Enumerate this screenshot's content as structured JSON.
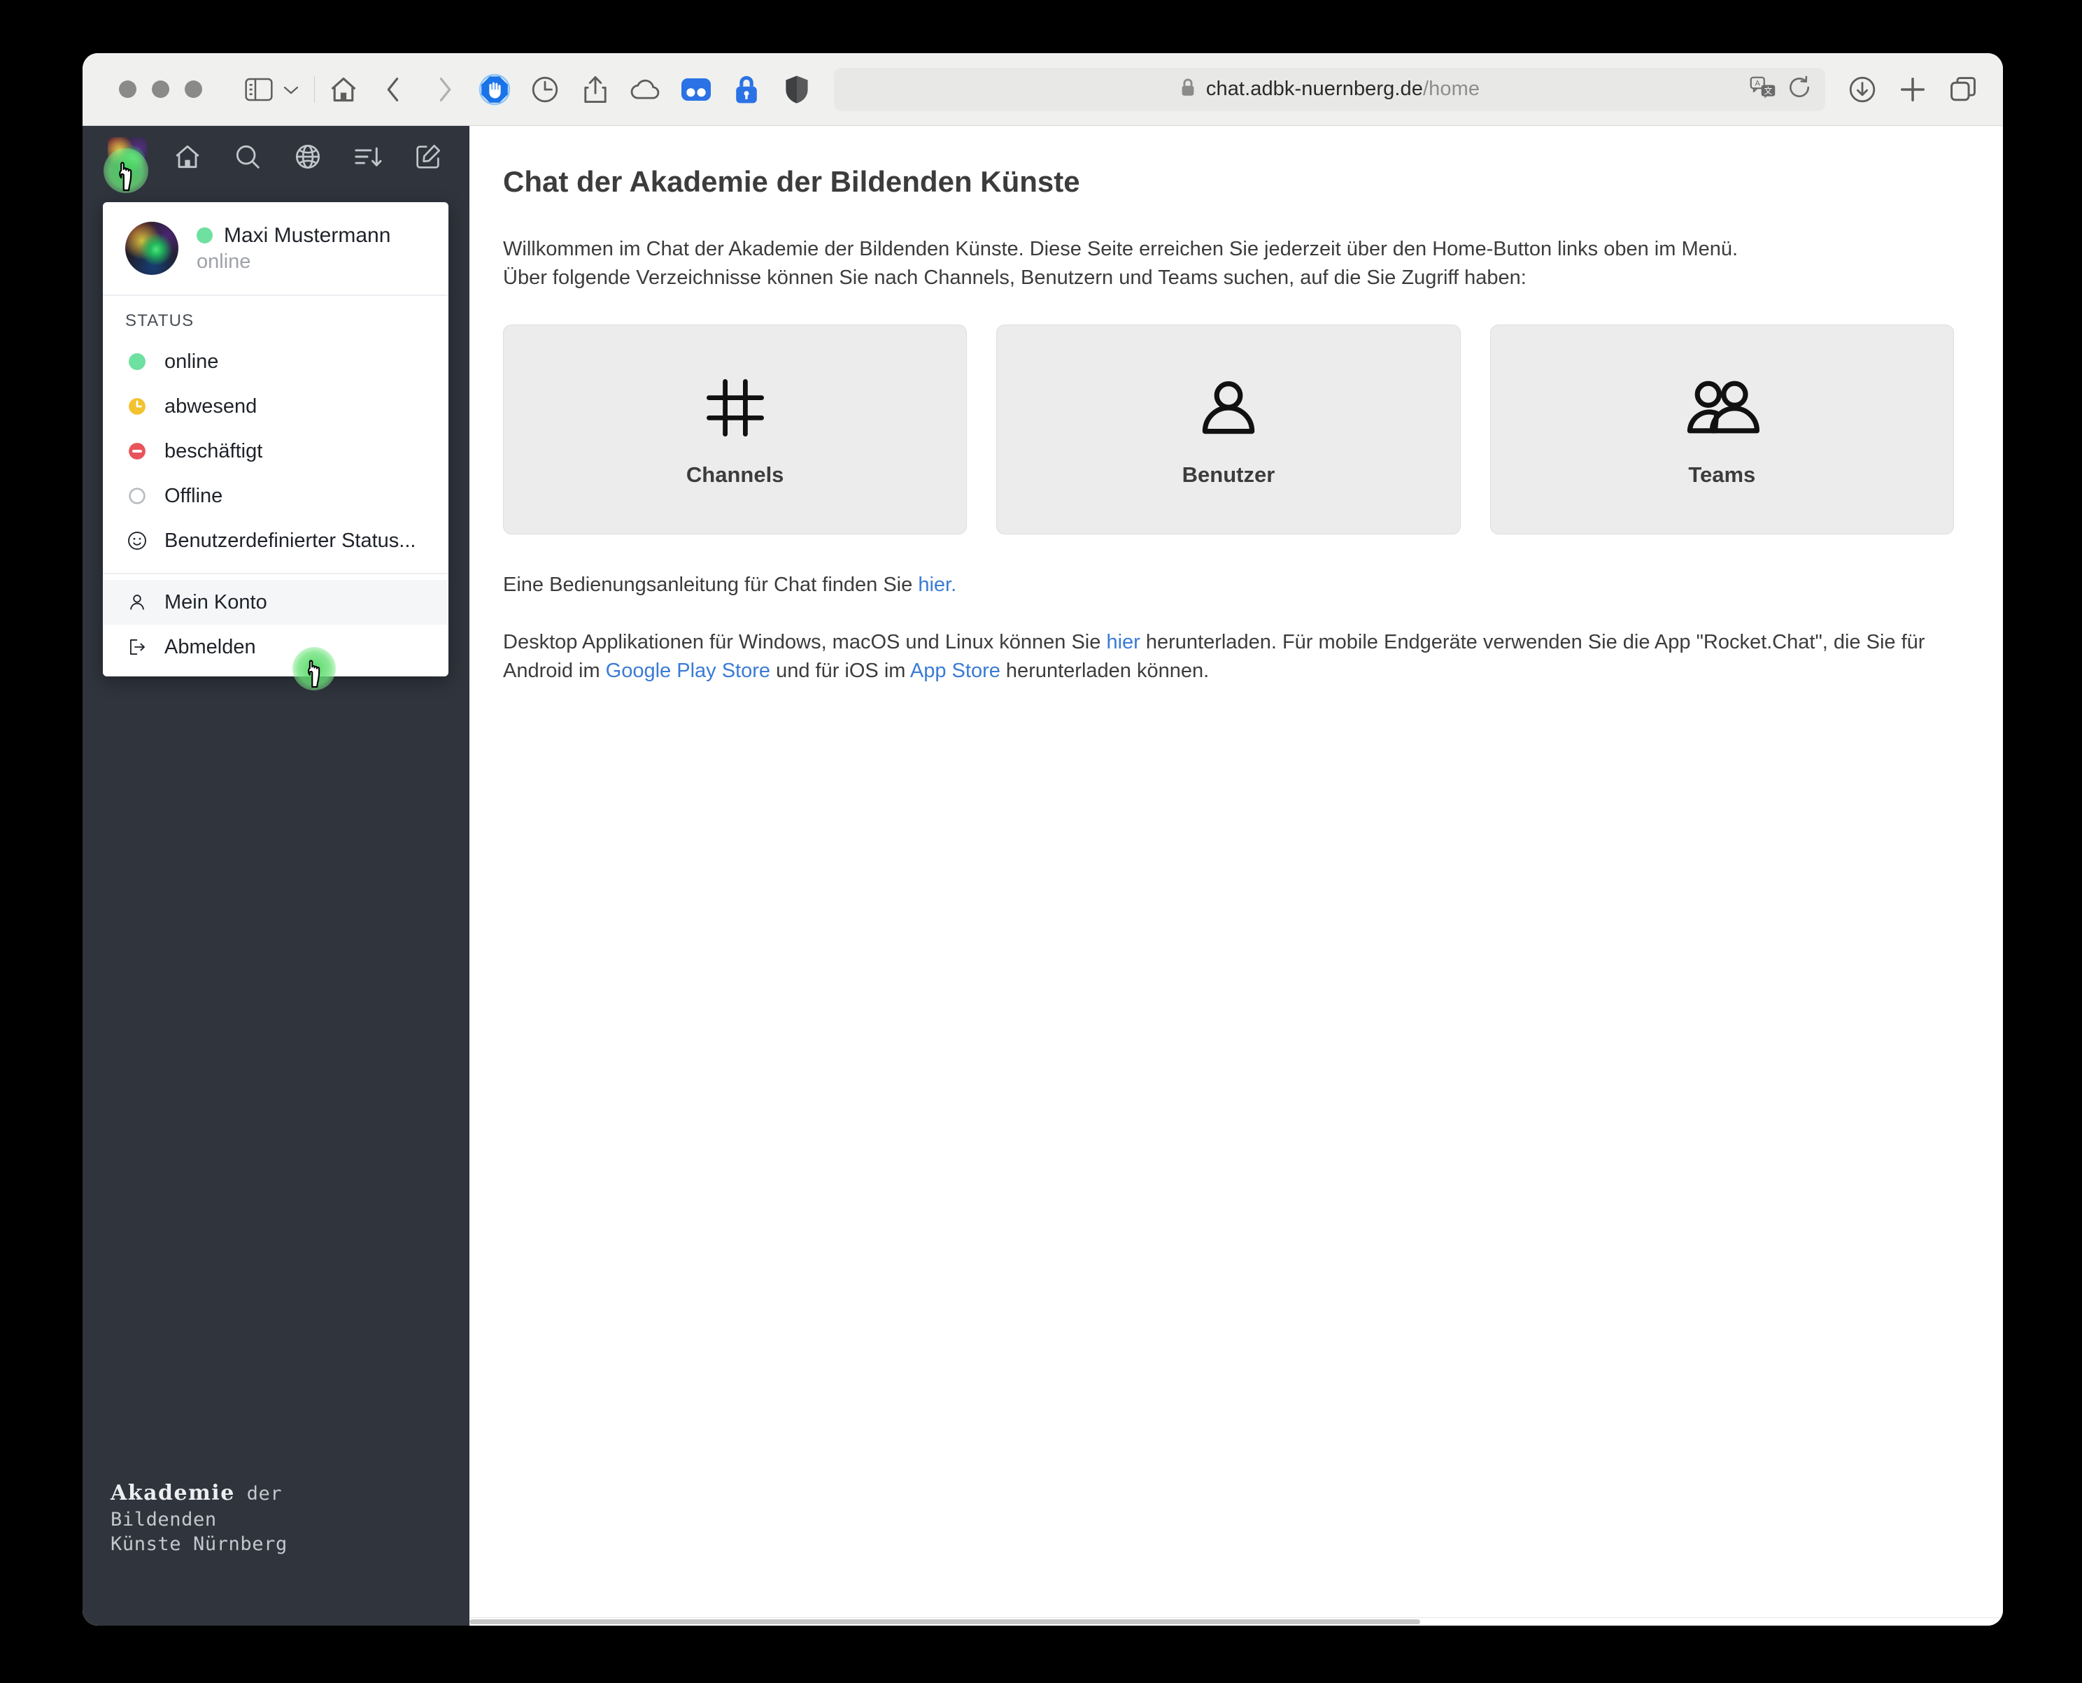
{
  "browser": {
    "traffic_lights": [
      "close",
      "minimize",
      "maximize"
    ],
    "toolbar_icons": [
      "sidebar-icon",
      "chevron-down-icon",
      "home-icon",
      "back-icon",
      "forward-icon",
      "adblock-icon",
      "history-clock-icon",
      "share-icon",
      "icloud-icon",
      "extension-blue-icon",
      "password-lock-icon",
      "shield-icon"
    ],
    "url": {
      "lock": "lock-icon",
      "domain": "chat.adbk-nuernberg.de",
      "path": "/home",
      "full": "chat.adbk-nuernberg.de/home"
    },
    "address_right_icons": [
      "translate-icon",
      "reload-icon"
    ],
    "right_icons": [
      "downloads-icon",
      "new-tab-icon",
      "tab-overview-icon"
    ]
  },
  "sidebar": {
    "avatar": "user-avatar",
    "icons": [
      "home-icon",
      "search-icon",
      "directory-globe-icon",
      "sort-icon",
      "create-new-icon"
    ],
    "logo": {
      "line1_strong": "Akademie",
      "line1_thin": "der",
      "line2": "Bildenden",
      "line3": "Künste Nürnberg"
    }
  },
  "user_menu": {
    "name": "Maxi Mustermann",
    "status_text": "online",
    "status_color": "#6ee0a0",
    "section_label": "STATUS",
    "status_options": [
      {
        "label": "online",
        "icon": "status-online-icon",
        "color": "#6ee0a0"
      },
      {
        "label": "abwesend",
        "icon": "status-away-icon",
        "color": "#f5c518"
      },
      {
        "label": "beschäftigt",
        "icon": "status-busy-icon",
        "color": "#e8545a"
      },
      {
        "label": "Offline",
        "icon": "status-offline-icon",
        "color": "#b5b9bf"
      },
      {
        "label": "Benutzerdefinierter Status...",
        "icon": "smiley-icon",
        "color": "#1f2329"
      }
    ],
    "account_items": [
      {
        "label": "Mein Konto",
        "icon": "person-icon",
        "hovered": true
      },
      {
        "label": "Abmelden",
        "icon": "logout-icon",
        "hovered": false
      }
    ]
  },
  "main": {
    "title": "Chat der Akademie der Bildenden Künste",
    "intro_line1": "Willkommen im Chat der Akademie der Bildenden Künste. Diese Seite erreichen Sie jederzeit über den Home-Button links oben im Menü.",
    "intro_line2": "Über folgende Verzeichnisse können Sie nach Channels, Benutzern und Teams suchen, auf die Sie Zugriff haben:",
    "cards": [
      {
        "label": "Channels",
        "icon": "hash-icon"
      },
      {
        "label": "Benutzer",
        "icon": "person-icon"
      },
      {
        "label": "Teams",
        "icon": "people-icon"
      }
    ],
    "manual_text_before": "Eine Bedienungsanleitung für Chat finden Sie ",
    "manual_link": "hier.",
    "desktop_before": "Desktop Applikationen für Windows, macOS und Linux können Sie ",
    "desktop_link": "hier",
    "desktop_middle": " herunterladen. Für mobile Endgeräte verwenden Sie die App \"Rocket.Chat\", die Sie für Android im ",
    "android_link": "Google Play Store",
    "desktop_middle2": " und für iOS im ",
    "ios_link": "App Store",
    "desktop_after": " herunterladen können."
  }
}
